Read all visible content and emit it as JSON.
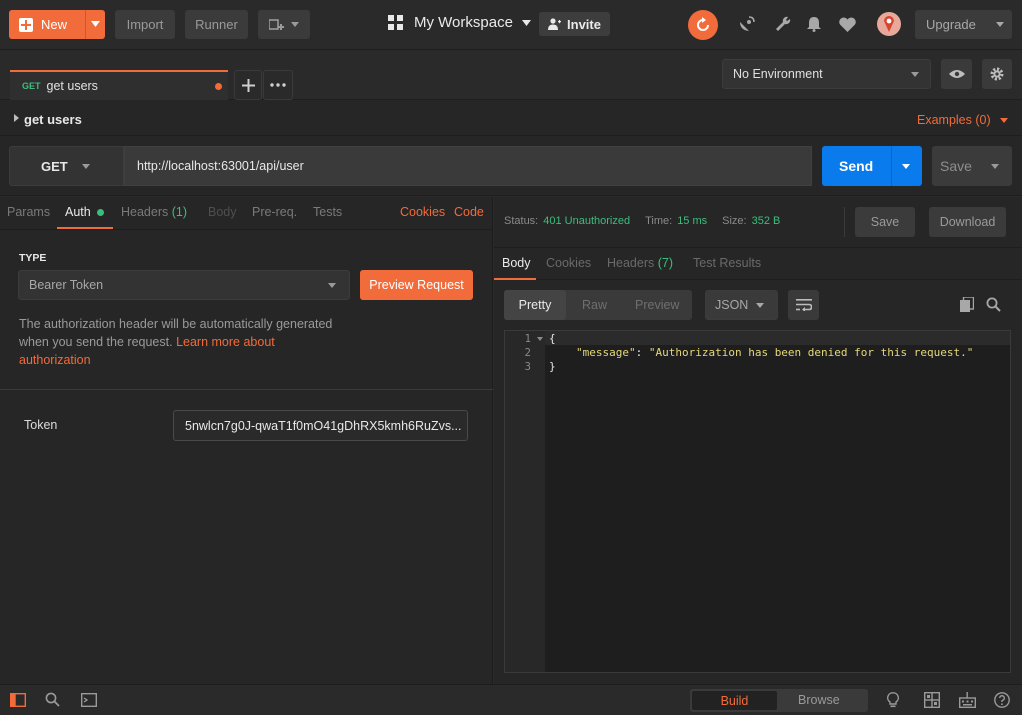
{
  "toolbar": {
    "new_label": "New",
    "import_label": "Import",
    "runner_label": "Runner",
    "workspace_label": "My Workspace",
    "invite_label": "Invite",
    "upgrade_label": "Upgrade"
  },
  "environment": {
    "selected": "No Environment"
  },
  "tabs": [
    {
      "method": "GET",
      "label": "get users"
    }
  ],
  "request": {
    "title": "get users",
    "examples_label": "Examples (0)",
    "method": "GET",
    "url": "http://localhost:63001/api/user",
    "send_label": "Send",
    "save_label": "Save"
  },
  "request_tabs": {
    "params": "Params",
    "auth": "Auth",
    "headers": "Headers",
    "headers_count": "(1)",
    "body": "Body",
    "prereq": "Pre-req.",
    "tests": "Tests",
    "cookies": "Cookies",
    "code": "Code"
  },
  "auth": {
    "type_label": "TYPE",
    "type_value": "Bearer Token",
    "preview_label": "Preview Request",
    "help_text": "The authorization header will be automatically generated when you send the request.",
    "help_link": "Learn more about authorization",
    "token_label": "Token",
    "token_value": "5nwlcn7g0J-qwaT1f0mO41gDhRX5kmh6RuZvs..."
  },
  "response": {
    "status_label": "Status:",
    "status_value": "401 Unauthorized",
    "time_label": "Time:",
    "time_value": "15 ms",
    "size_label": "Size:",
    "size_value": "352 B",
    "save_label": "Save",
    "download_label": "Download",
    "tabs": {
      "body": "Body",
      "cookies": "Cookies",
      "headers": "Headers",
      "headers_count": "(7)",
      "tests": "Test Results"
    },
    "view": {
      "pretty": "Pretty",
      "raw": "Raw",
      "preview": "Preview",
      "format": "JSON"
    },
    "lines": [
      {
        "no": "1",
        "text": "{"
      },
      {
        "no": "2",
        "key": "\"message\"",
        "value": "\"Authorization has been denied for this request.\""
      },
      {
        "no": "3",
        "text": "}"
      }
    ]
  },
  "statusbar": {
    "build": "Build",
    "browse": "Browse"
  },
  "colors": {
    "accent": "#f26b3a",
    "send": "#097bed",
    "status_ok": "#3dbd7d",
    "json_string": "#e5d87a",
    "json_key": "#e5d87a"
  }
}
